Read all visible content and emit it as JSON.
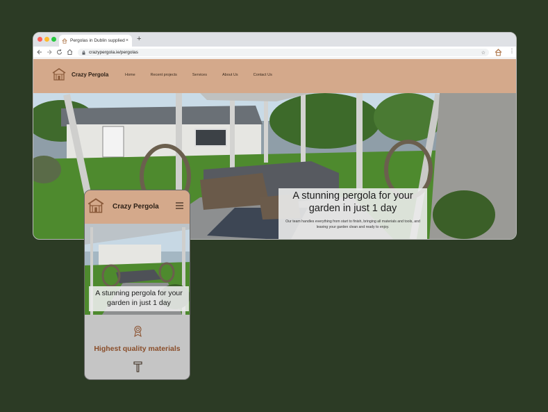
{
  "browser": {
    "tab_title": "Pergolas in Dublin supplied",
    "tab_close": "×",
    "new_tab": "+",
    "url": "crazypergola.ie/pergolas"
  },
  "site": {
    "brand": "Crazy Pergola",
    "nav": [
      "Home",
      "Recent projects",
      "Services",
      "About Us",
      "Contact Us"
    ],
    "hero_title": "A stunning pergola for your garden in just 1 day",
    "hero_subtitle": "Our team handles everything from start to finish, bringing all materials and tools, and leaving your garden clean and ready to enjoy."
  },
  "mobile": {
    "brand": "Crazy Pergola",
    "hero_title": "A stunning pergola for your garden in just 1 day",
    "feature_title": "Highest quality materials"
  },
  "colors": {
    "background": "#2c3b25",
    "header": "#d4a98b",
    "accent": "#8a4e2a"
  }
}
